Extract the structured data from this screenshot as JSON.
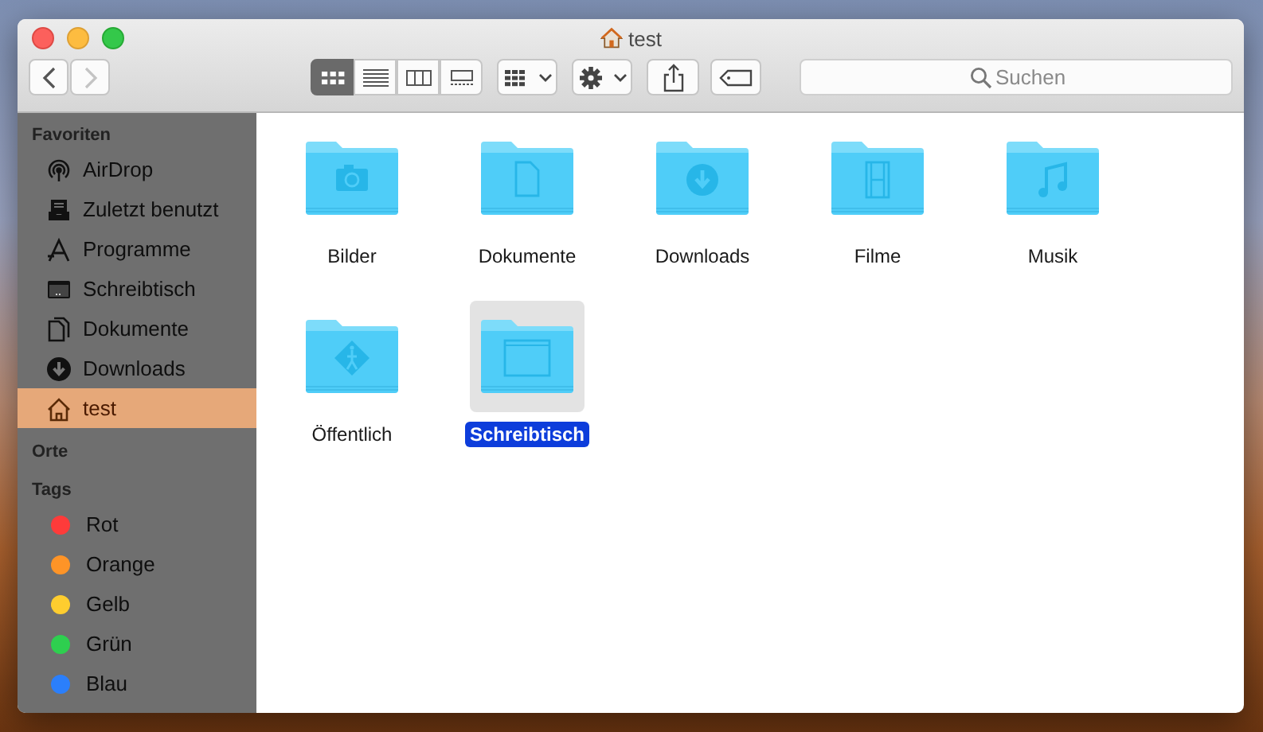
{
  "window": {
    "title": "test"
  },
  "toolbar": {
    "back": {
      "disabled": false
    },
    "forward": {
      "disabled": true
    },
    "view_modes": [
      {
        "kind": "icons",
        "selected": true
      },
      {
        "kind": "list",
        "selected": false
      },
      {
        "kind": "columns",
        "selected": false
      },
      {
        "kind": "gallery",
        "selected": false
      }
    ],
    "search": {
      "placeholder": "Suchen"
    }
  },
  "sidebar": {
    "favorites": {
      "title": "Favoriten",
      "items": [
        {
          "label": "AirDrop",
          "selected": false
        },
        {
          "label": "Zuletzt benutzt",
          "selected": false
        },
        {
          "label": "Programme",
          "selected": false
        },
        {
          "label": "Schreibtisch",
          "selected": false
        },
        {
          "label": "Dokumente",
          "selected": false
        },
        {
          "label": "Downloads",
          "selected": false
        },
        {
          "label": "test",
          "selected": true
        }
      ]
    },
    "places": {
      "title": "Orte"
    },
    "tags": {
      "title": "Tags",
      "items": [
        {
          "label": "Rot",
          "color": "#fe3b3a"
        },
        {
          "label": "Orange",
          "color": "#fe9427"
        },
        {
          "label": "Gelb",
          "color": "#fecd2f"
        },
        {
          "label": "Grün",
          "color": "#2ecf4f"
        },
        {
          "label": "Blau",
          "color": "#2b7ffb"
        }
      ]
    }
  },
  "files": [
    {
      "name": "Bilder",
      "kind": "pictures",
      "selected": false
    },
    {
      "name": "Dokumente",
      "kind": "documents",
      "selected": false
    },
    {
      "name": "Downloads",
      "kind": "downloads",
      "selected": false
    },
    {
      "name": "Filme",
      "kind": "movies",
      "selected": false
    },
    {
      "name": "Musik",
      "kind": "music",
      "selected": false
    },
    {
      "name": "Öffentlich",
      "kind": "public",
      "selected": false
    },
    {
      "name": "Schreibtisch",
      "kind": "desktop",
      "selected": true
    }
  ]
}
